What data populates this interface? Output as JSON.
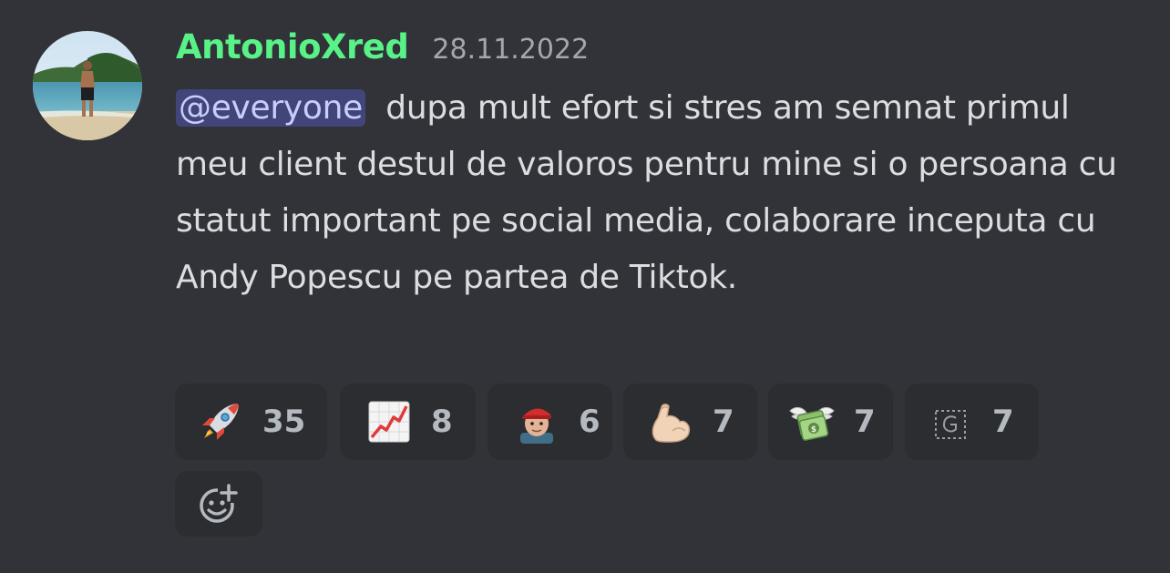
{
  "message": {
    "author": "AntonioXred",
    "timestamp": "28.11.2022",
    "mention": "@everyone",
    "text": "dupa mult efort si stres am semnat primul meu client destul de valoros pentru mine si o persoana cu statut important pe social media, colaborare inceputa cu Andy Popescu pe partea de Tiktok."
  },
  "reactions": [
    {
      "emoji": "rocket-icon",
      "count": "35"
    },
    {
      "emoji": "chart-increasing-icon",
      "count": "8"
    },
    {
      "emoji": "custom-face-emoji",
      "count": "6"
    },
    {
      "emoji": "flexed-biceps-icon",
      "count": "7"
    },
    {
      "emoji": "money-with-wings-icon",
      "count": "7"
    },
    {
      "emoji": "custom-g-emoji",
      "count": "7"
    }
  ],
  "colors": {
    "background": "#313338",
    "username": "#58f287",
    "mention_bg": "#41457a",
    "reaction_bg": "#2b2d31"
  }
}
